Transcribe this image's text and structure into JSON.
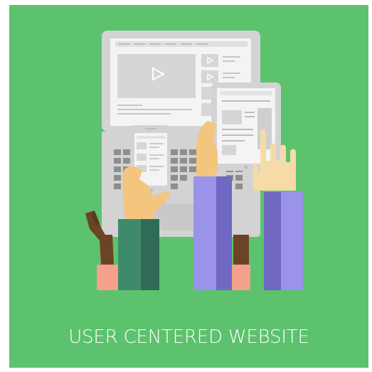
{
  "caption": "USER CENTERED WEBSITE",
  "colors": {
    "background": "#5cc26e",
    "laptop": "#d9d9d9",
    "screen": "#f2f2f2",
    "sleeve_green": "#3f8a6c",
    "sleeve_purple": "#9b93ea",
    "skin": "#f3c57f",
    "cuff_pink": "#f3a08c"
  },
  "icons": [
    "play-icon",
    "laptop-icon",
    "tablet-icon",
    "smartphone-icon",
    "hand-icon"
  ]
}
